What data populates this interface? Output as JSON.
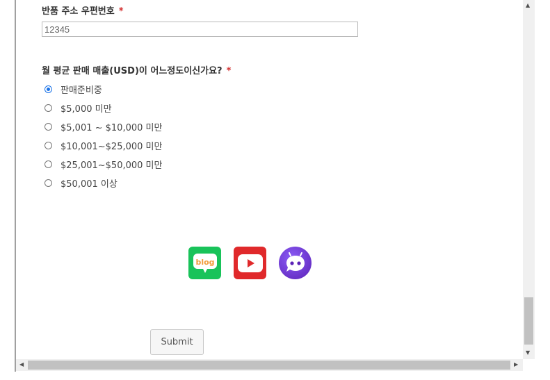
{
  "form": {
    "zip_field": {
      "label": "반품 주소 우편번호",
      "required_mark": "*",
      "value": "12345"
    },
    "sales_question": {
      "label": "월 평균 판매 매출(USD)이 어느정도이신가요?",
      "required_mark": "*",
      "options": [
        {
          "label": "판매준비중",
          "checked": true
        },
        {
          "label": "$5,000 미만",
          "checked": false
        },
        {
          "label": "$5,001 ~ $10,000 미만",
          "checked": false
        },
        {
          "label": "$10,001~$25,000 미만",
          "checked": false
        },
        {
          "label": "$25,001~$50,000 미만",
          "checked": false
        },
        {
          "label": "$50,001 이상",
          "checked": false
        }
      ]
    },
    "social_links": [
      {
        "name": "blog",
        "text": "blog",
        "icon": "naver-blog-icon",
        "color": "#19c35a"
      },
      {
        "name": "youtube",
        "icon": "youtube-play-icon",
        "color": "#e0292b"
      },
      {
        "name": "channel",
        "icon": "chatbot-icon",
        "color": "#6d28d9"
      }
    ],
    "submit_label": "Submit"
  },
  "colors": {
    "accent": "#1a73e8",
    "required": "#d32f2f"
  }
}
